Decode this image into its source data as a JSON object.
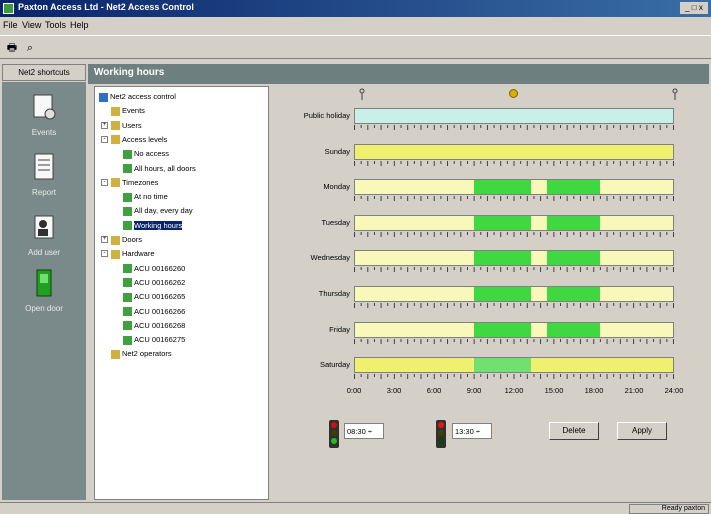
{
  "window": {
    "title": "Paxton Access Ltd - Net2 Access Control",
    "buttons": "_ □ x"
  },
  "menu": [
    "File",
    "View",
    "Tools",
    "Help"
  ],
  "toolbar": {
    "print": "print-icon",
    "find": "binoculars-icon"
  },
  "sidebar": {
    "tab": "Net2 shortcuts",
    "items": [
      {
        "label": "Events",
        "icon": "events-icon"
      },
      {
        "label": "Report",
        "icon": "report-icon"
      },
      {
        "label": "Add user",
        "icon": "add-user-icon"
      },
      {
        "label": "Open door",
        "icon": "open-door-icon"
      }
    ]
  },
  "panel": {
    "title": "Working hours"
  },
  "tree": [
    {
      "label": "Net2 access control",
      "level": 0,
      "expander": ""
    },
    {
      "label": "Events",
      "level": 1,
      "expander": ""
    },
    {
      "label": "Users",
      "level": 1,
      "expander": "+"
    },
    {
      "label": "Access levels",
      "level": 1,
      "expander": "-"
    },
    {
      "label": "No access",
      "level": 2,
      "expander": ""
    },
    {
      "label": "All hours, all doors",
      "level": 2,
      "expander": ""
    },
    {
      "label": "Timezones",
      "level": 1,
      "expander": "-"
    },
    {
      "label": "At no time",
      "level": 2,
      "expander": ""
    },
    {
      "label": "All day, every day",
      "level": 2,
      "expander": ""
    },
    {
      "label": "Working hours",
      "level": 2,
      "expander": "",
      "selected": true
    },
    {
      "label": "Doors",
      "level": 1,
      "expander": "+"
    },
    {
      "label": "Hardware",
      "level": 1,
      "expander": "-"
    },
    {
      "label": "ACU 00166260",
      "level": 2,
      "expander": ""
    },
    {
      "label": "ACU 00166262",
      "level": 2,
      "expander": ""
    },
    {
      "label": "ACU 00166265",
      "level": 2,
      "expander": ""
    },
    {
      "label": "ACU 00166266",
      "level": 2,
      "expander": ""
    },
    {
      "label": "ACU 00166268",
      "level": 2,
      "expander": ""
    },
    {
      "label": "ACU 00166275",
      "level": 2,
      "expander": ""
    },
    {
      "label": "Net2 operators",
      "level": 1,
      "expander": ""
    }
  ],
  "schedule": {
    "days": [
      {
        "label": "Public holiday",
        "base": "#c8f0e8",
        "segments": []
      },
      {
        "label": "Sunday",
        "base": "#f0f070",
        "segments": []
      },
      {
        "label": "Monday",
        "base": "#f8f8b8",
        "segments": [
          [
            9.0,
            13.25,
            "#40d840"
          ],
          [
            14.5,
            18.5,
            "#40d840"
          ]
        ]
      },
      {
        "label": "Tuesday",
        "base": "#f8f8b8",
        "segments": [
          [
            9.0,
            13.25,
            "#40d840"
          ],
          [
            14.5,
            18.5,
            "#40d840"
          ]
        ]
      },
      {
        "label": "Wednesday",
        "base": "#f8f8b8",
        "segments": [
          [
            9.0,
            13.25,
            "#40d840"
          ],
          [
            14.5,
            18.5,
            "#40d840"
          ]
        ]
      },
      {
        "label": "Thursday",
        "base": "#f8f8b8",
        "segments": [
          [
            9.0,
            13.25,
            "#40d840"
          ],
          [
            14.5,
            18.5,
            "#40d840"
          ]
        ]
      },
      {
        "label": "Friday",
        "base": "#f8f8b8",
        "segments": [
          [
            9.0,
            13.25,
            "#40d840"
          ],
          [
            14.5,
            18.5,
            "#40d840"
          ]
        ]
      },
      {
        "label": "Saturday",
        "base": "#f0f070",
        "segments": [
          [
            9.0,
            13.25,
            "#70e070"
          ]
        ]
      }
    ],
    "hours": [
      "0:00",
      "3:00",
      "6:00",
      "9:00",
      "12:00",
      "15:00",
      "18:00",
      "21:00",
      "24:00"
    ],
    "start_time": "08:30",
    "end_time": "13:30",
    "delete_label": "Delete",
    "apply_label": "Apply"
  },
  "status": {
    "right": "Ready  paxton"
  }
}
